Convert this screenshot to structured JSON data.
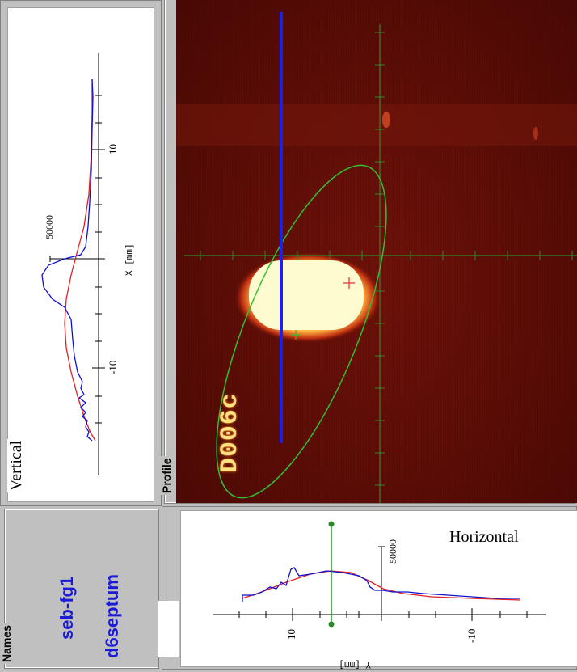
{
  "vertical": {
    "title": "Vertical",
    "axis_label": "X [mm]",
    "ticks": [
      "10",
      "-10"
    ],
    "peak_label": "50000"
  },
  "profile": {
    "group_label": "Profile",
    "overlay_text": "D006c"
  },
  "names": {
    "group_label": "Names",
    "items": [
      "seb-fg1",
      "d6septum"
    ]
  },
  "horizontal": {
    "title": "Horizontal",
    "axis_label": "Y [mm]",
    "ticks": [
      "10",
      "-10"
    ],
    "peak_label": "50000"
  },
  "colors": {
    "measured_trace": "#1010d0",
    "fit_trace": "#e02020",
    "ellipse": "#30c030",
    "cursor_line": "#2020e0",
    "crosshair": "#2a8a2a",
    "beam_core": "#fffbd0",
    "camera_bg": "#5a0c06",
    "name_text": "#1a1ad8"
  }
}
